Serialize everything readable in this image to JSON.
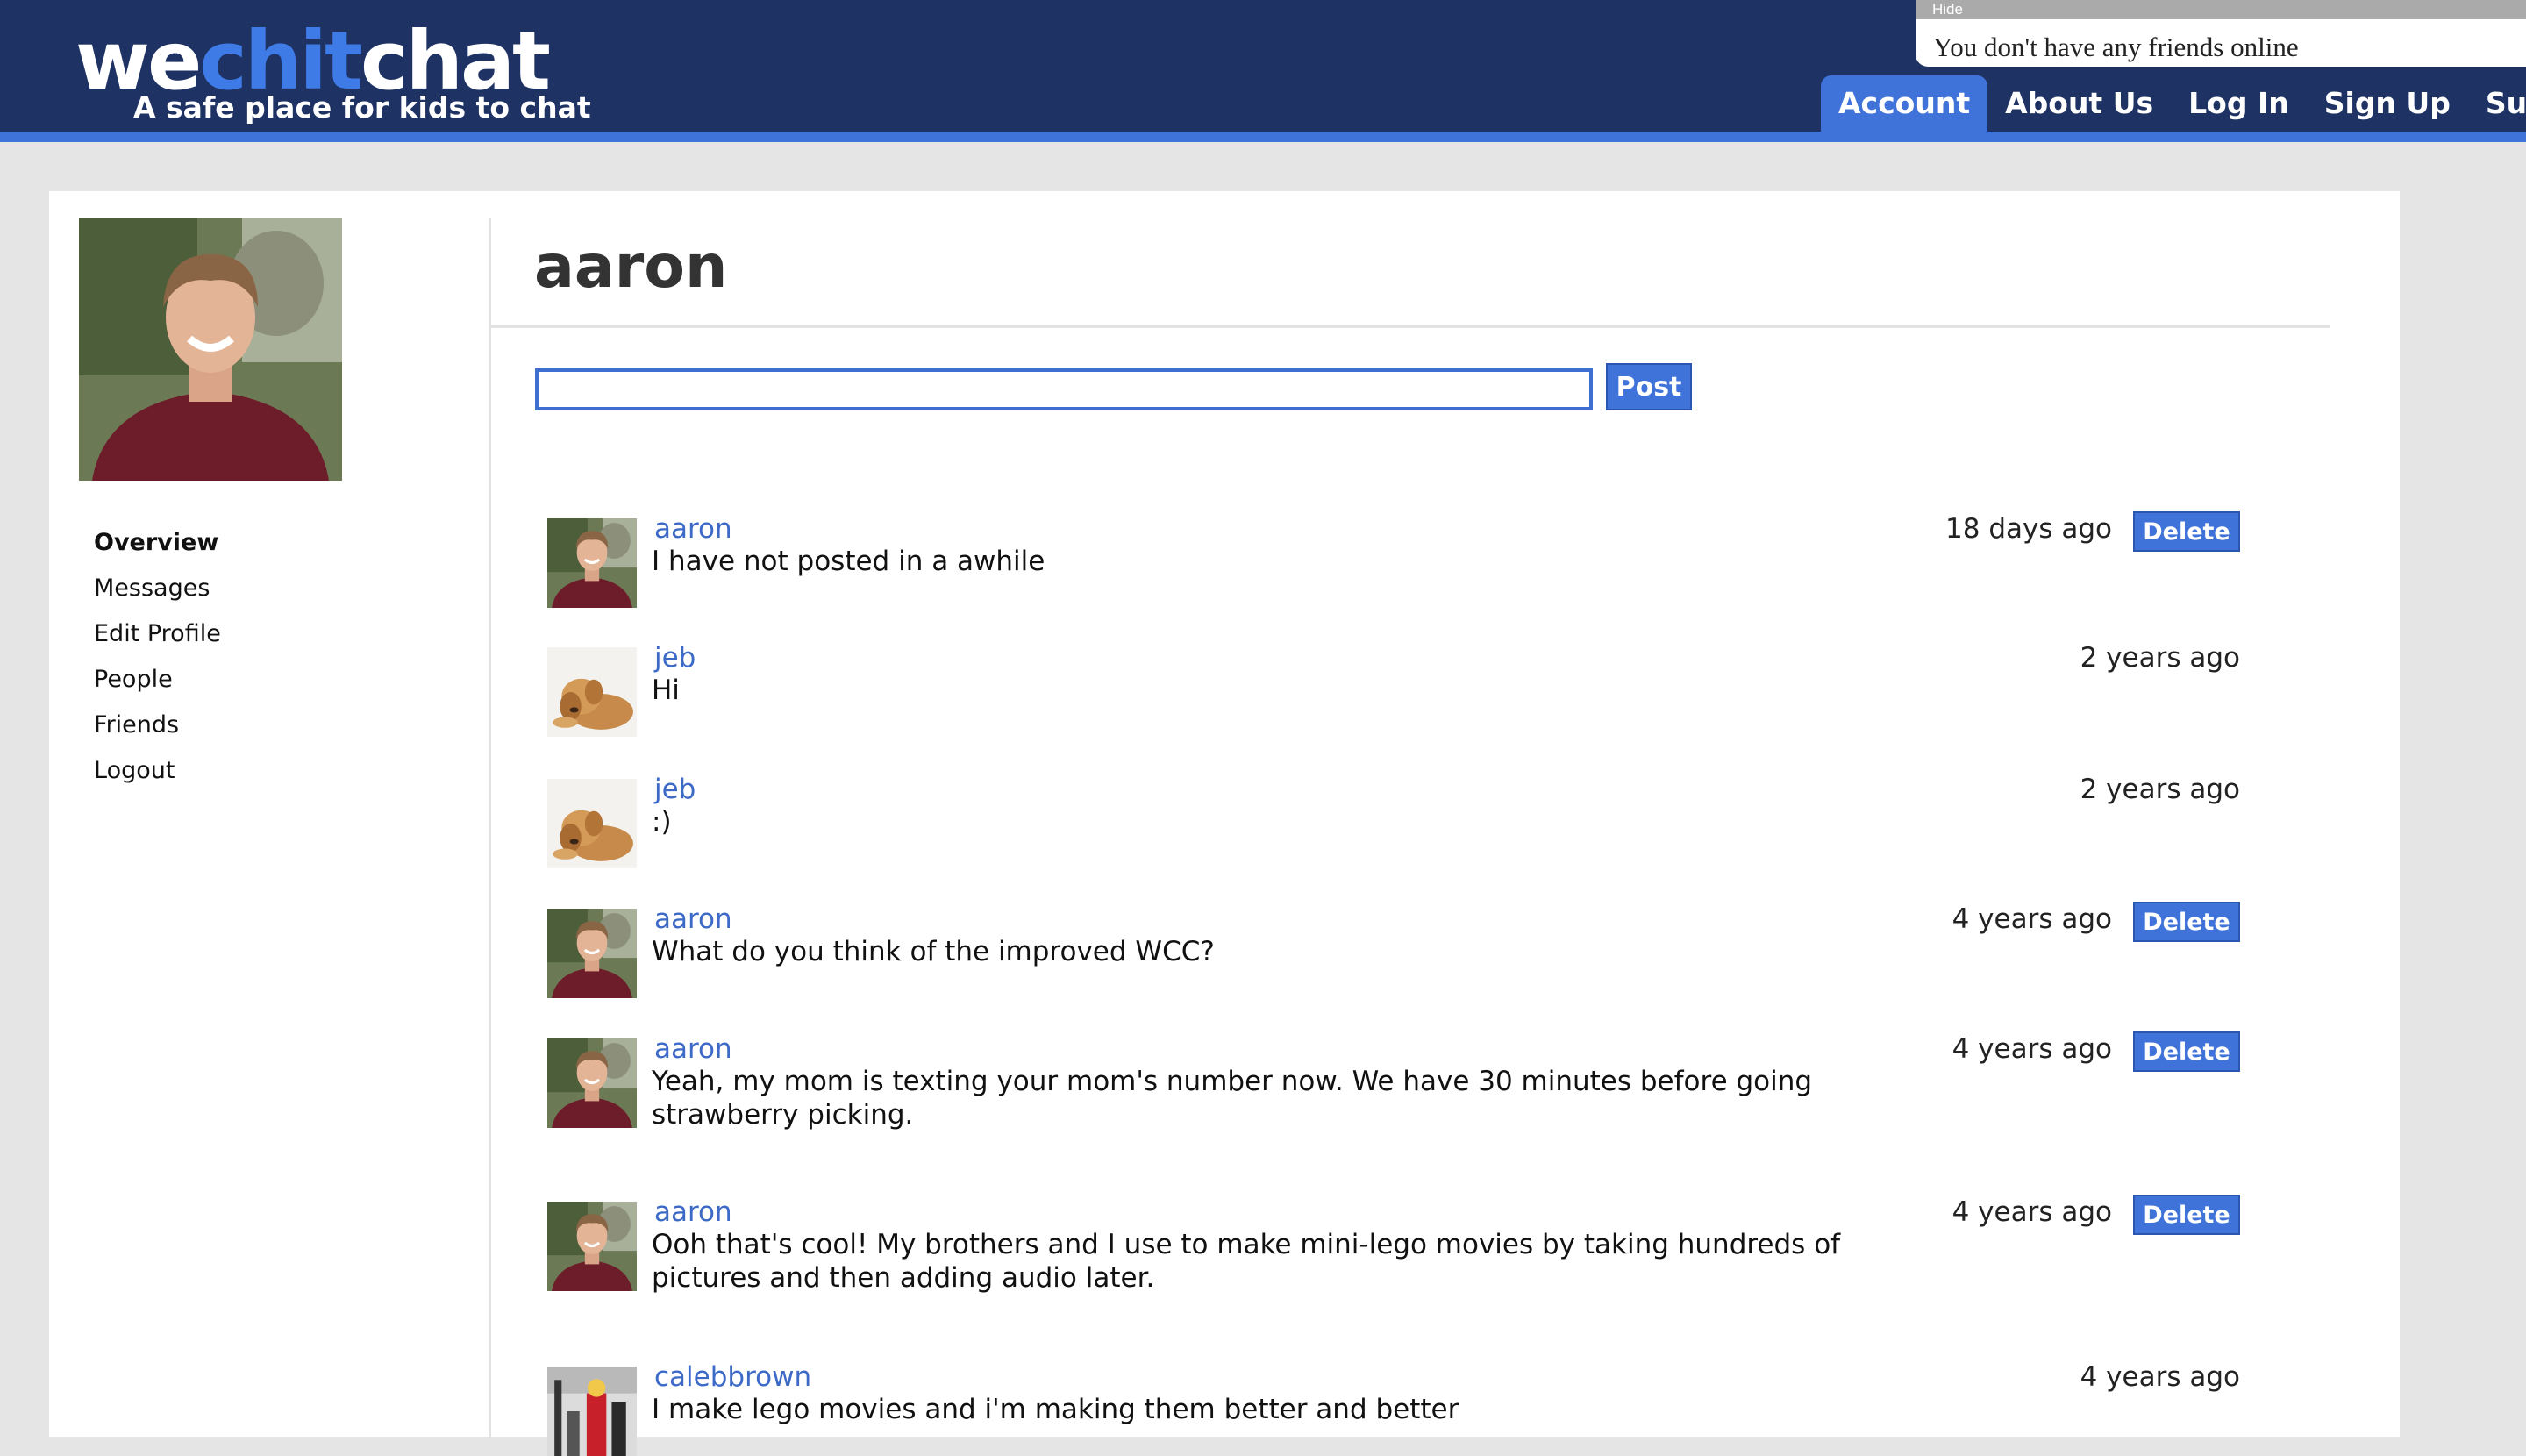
{
  "header": {
    "logo": {
      "part1": "we",
      "part2": "chit",
      "part3": "chat"
    },
    "tagline": "A safe place for kids to chat",
    "nav": [
      "Account",
      "About Us",
      "Log In",
      "Sign Up",
      "Support"
    ],
    "active_nav": "Account"
  },
  "friends_widget": {
    "hide_label": "Hide",
    "status": "You don't have any friends online"
  },
  "sidebar": {
    "menu": [
      "Overview",
      "Messages",
      "Edit Profile",
      "People",
      "Friends",
      "Logout"
    ],
    "active": "Overview"
  },
  "profile": {
    "name": "aaron"
  },
  "composer": {
    "input_value": "",
    "post_label": "Post"
  },
  "posts": [
    {
      "author": "aaron",
      "avatar": "person-avatar",
      "message": "I have not posted in a awhile",
      "time": "18 days ago",
      "delete_label": "Delete"
    },
    {
      "author": "jeb",
      "avatar": "puppy-avatar",
      "message": "Hi",
      "time": "2 years ago",
      "delete_label": ""
    },
    {
      "author": "jeb",
      "avatar": "puppy-avatar",
      "message": ":)",
      "time": "2 years ago",
      "delete_label": ""
    },
    {
      "author": "aaron",
      "avatar": "person-avatar",
      "message": "What do you think of the improved WCC?",
      "time": "4 years ago",
      "delete_label": "Delete"
    },
    {
      "author": "aaron",
      "avatar": "person-avatar",
      "message": "Yeah, my mom is texting your mom's number now. We have 30 minutes before going strawberry picking.",
      "time": "4 years ago",
      "delete_label": "Delete"
    },
    {
      "author": "aaron",
      "avatar": "person-avatar",
      "message": "Ooh that's cool! My brothers and I use to make mini-lego movies by taking hundreds of pictures and then adding audio later.",
      "time": "4 years ago",
      "delete_label": "Delete"
    },
    {
      "author": "calebbrown",
      "avatar": "lego-avatar",
      "message": "I make lego movies and i'm making them better and better",
      "time": "4 years ago",
      "delete_label": ""
    }
  ],
  "colors": {
    "header_bg": "#1e3264",
    "accent": "#3f73d9",
    "link": "#3d6ac7"
  }
}
